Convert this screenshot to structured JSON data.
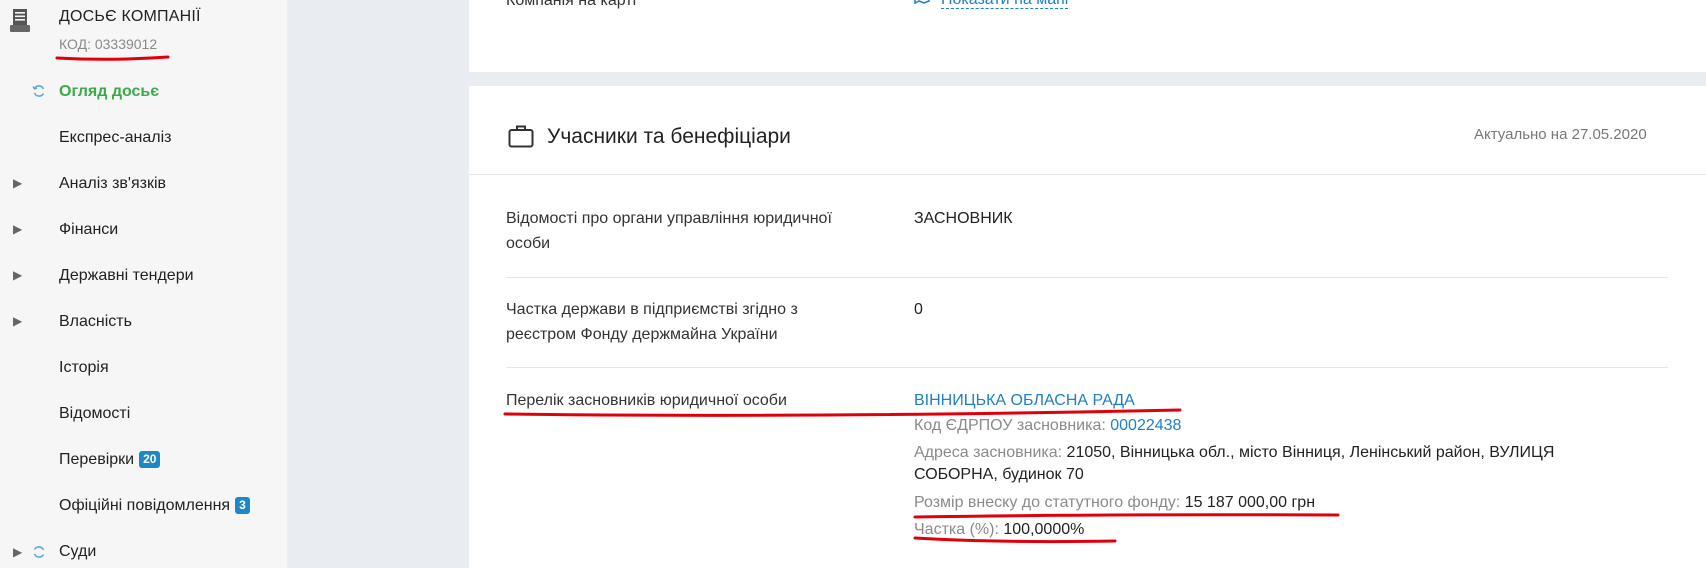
{
  "sidebar": {
    "title": "ДОСЬЄ КОМПАНІЇ",
    "code": "КОД: 03339012",
    "items": [
      {
        "label": "Огляд досьє",
        "active": true
      },
      {
        "label": "Експрес-аналіз"
      },
      {
        "label": "Аналіз зв'язків"
      },
      {
        "label": "Фінанси"
      },
      {
        "label": "Державні тендери"
      },
      {
        "label": "Власність"
      },
      {
        "label": "Історія"
      },
      {
        "label": "Відомості"
      },
      {
        "label": "Перевірки",
        "badge": "20"
      },
      {
        "label": "Офіційні повідомлення",
        "badge": "3"
      },
      {
        "label": "Суди"
      }
    ]
  },
  "top_section": {
    "label": "Компанія на карті",
    "link": "Показати на мапі"
  },
  "card": {
    "title": "Учасники та бенефіціари",
    "actual": "Актуально на 27.05.2020",
    "rows": [
      {
        "label_1": "Відомості про органи управління юридичної",
        "label_2": "особи",
        "value": "ЗАСНОВНИК"
      },
      {
        "label_1": "Частка держави в підприємстві згідно з",
        "label_2": "реєстром Фонду держмайна України",
        "value": "0"
      },
      {
        "label": "Перелік засновників юридичної особи"
      }
    ],
    "founder": {
      "name": "ВІННИЦЬКА ОБЛАСНА РАДА",
      "code_label": "Код ЄДРПОУ засновника:",
      "code_value": "00022438",
      "address_label": "Адреса засновника:",
      "address_line1": "21050, Вінницька обл., місто Вінниця, Ленінський район, ВУЛИЦЯ",
      "address_line2": "СОБОРНА, будинок 70",
      "contribution_label": "Розмір внеску до статутного фонду:",
      "contribution_value": "15 187 000,00 грн",
      "share_label": "Частка (%):",
      "share_value": "100,0000%"
    }
  },
  "colors": {
    "accent_link": "#1e7fc4",
    "active_nav": "#3aaa4a",
    "badge": "#1e88c7",
    "annotation": "#e0000b"
  }
}
